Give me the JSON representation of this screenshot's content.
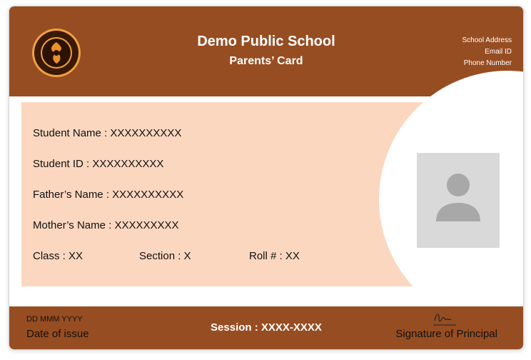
{
  "header": {
    "school_name": "Demo Public School",
    "card_type": "Parents’ Card",
    "address": "School Address",
    "email": "Email ID",
    "phone": "Phone Number",
    "logo_icon": "school-seal-icon"
  },
  "fields": {
    "student_name": "Student Name :  XXXXXXXXXX",
    "student_id": "Student ID :  XXXXXXXXXX",
    "father_name": "Father’s Name :  XXXXXXXXXX",
    "mother_name": "Mother’s Name :  XXXXXXXXX",
    "class": "Class : XX",
    "section": "Section : X",
    "roll": "Roll # : XX"
  },
  "photo": {
    "icon": "user-avatar-placeholder-icon"
  },
  "footer": {
    "date_value": "DD MMM YYYY",
    "date_label": "Date of issue",
    "session": "Session : XXXX-XXXX",
    "signature_label": "Signature of Principal",
    "signature_icon": "signature-icon"
  },
  "colors": {
    "brand_brown": "#974d22",
    "panel_peach": "#fcd7c0",
    "photo_gray": "#d9d9d9"
  }
}
